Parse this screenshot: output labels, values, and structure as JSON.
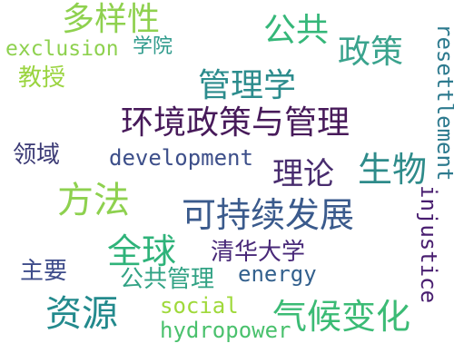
{
  "words": {
    "duoyangxing": {
      "text": "多样性",
      "color": "#8fd14f"
    },
    "gonggong": {
      "text": "公共",
      "color": "#35b779"
    },
    "zhengce": {
      "text": "政策",
      "color": "#3aa38d"
    },
    "exclusion": {
      "text": "exclusion",
      "color": "#8ed14f"
    },
    "xueyuan": {
      "text": "学院",
      "color": "#2f9b8c"
    },
    "jiaoshou": {
      "text": "教授",
      "color": "#9ad43f"
    },
    "guanlixue": {
      "text": "管理学",
      "color": "#2c8c8d"
    },
    "huanjing": {
      "text": "环境政策与管理",
      "color": "#471a5a"
    },
    "lingyu": {
      "text": "领域",
      "color": "#3b3a75"
    },
    "development": {
      "text": "development",
      "color": "#3d4f8a"
    },
    "lilun": {
      "text": "理论",
      "color": "#482c6e"
    },
    "shengwu": {
      "text": "生物",
      "color": "#2e8b8a"
    },
    "fangfa": {
      "text": "方法",
      "color": "#8ed14f"
    },
    "kechixu": {
      "text": "可持续发展",
      "color": "#3a5a8c"
    },
    "quanqiu": {
      "text": "全球",
      "color": "#2fb37a"
    },
    "qinghua": {
      "text": "清华大学",
      "color": "#482878"
    },
    "zhuyao": {
      "text": "主要",
      "color": "#3e4c8a"
    },
    "gonggongguanli": {
      "text": "公共管理",
      "color": "#31a284"
    },
    "energy": {
      "text": "energy",
      "color": "#33608d"
    },
    "social": {
      "text": "social",
      "color": "#9fd93a"
    },
    "ziyuan": {
      "text": "资源",
      "color": "#238a8d"
    },
    "qihou": {
      "text": "气候变化",
      "color": "#3bbb75"
    },
    "hydropower": {
      "text": "hydropower",
      "color": "#4ac16d"
    },
    "resettlement": {
      "text": "resettlement",
      "color": "#2d7a8e"
    },
    "injustice": {
      "text": "injustice",
      "color": "#481d6f"
    }
  }
}
